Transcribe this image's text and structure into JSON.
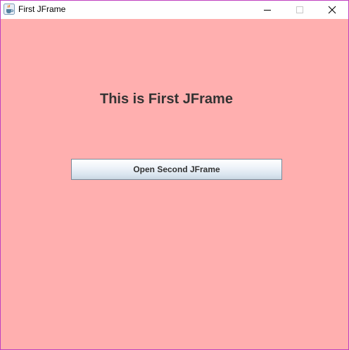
{
  "window": {
    "title": "First JFrame",
    "icon": "java-coffee-cup-icon",
    "controls": {
      "minimize": "minimize-icon",
      "maximize": "maximize-icon",
      "close": "close-icon"
    }
  },
  "content": {
    "heading": "This is First JFrame",
    "button_label": "Open Second JFrame"
  },
  "colors": {
    "background": "#ffafaf",
    "border": "#c040c0",
    "text": "#333333"
  }
}
